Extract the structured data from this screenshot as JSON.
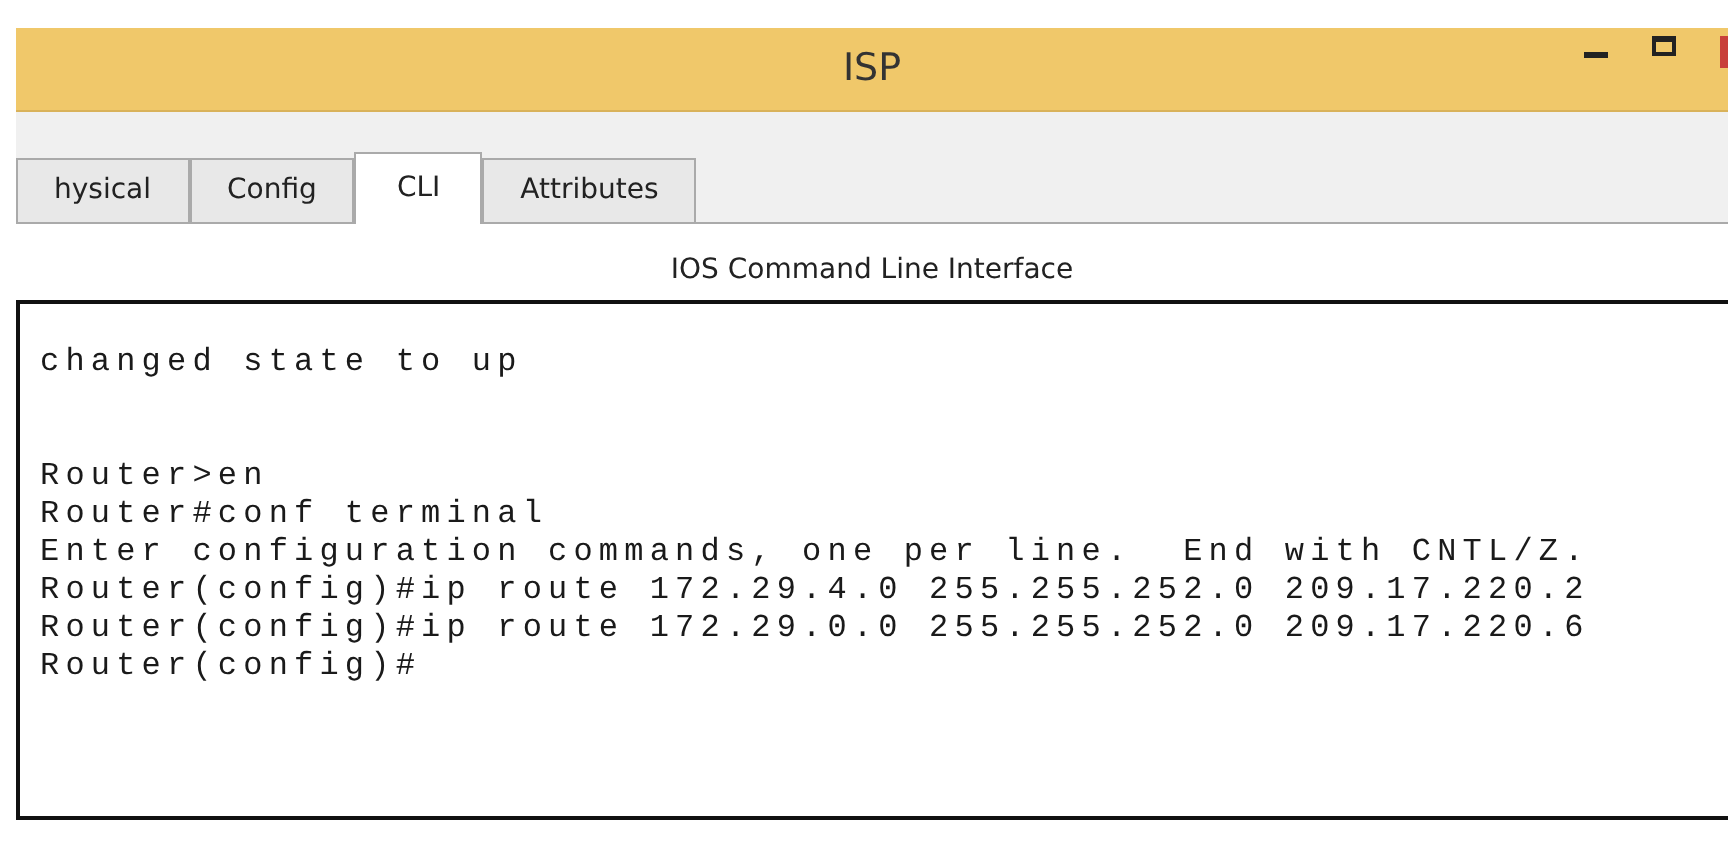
{
  "window": {
    "title": "ISP"
  },
  "tabs": [
    {
      "label": "hysical",
      "selected": false
    },
    {
      "label": "Config",
      "selected": false
    },
    {
      "label": "CLI",
      "selected": true
    },
    {
      "label": "Attributes",
      "selected": false
    }
  ],
  "panel_title": "IOS Command Line Interface",
  "console_blocks": [
    [
      "changed state to up"
    ],
    [
      "Router>en",
      "Router#conf terminal",
      "Enter configuration commands, one per line.  End with CNTL/Z.",
      "Router(config)#ip route 172.29.4.0 255.255.252.0 209.17.220.2",
      "Router(config)#ip route 172.29.0.0 255.255.252.0 209.17.220.6",
      "Router(config)#"
    ]
  ]
}
